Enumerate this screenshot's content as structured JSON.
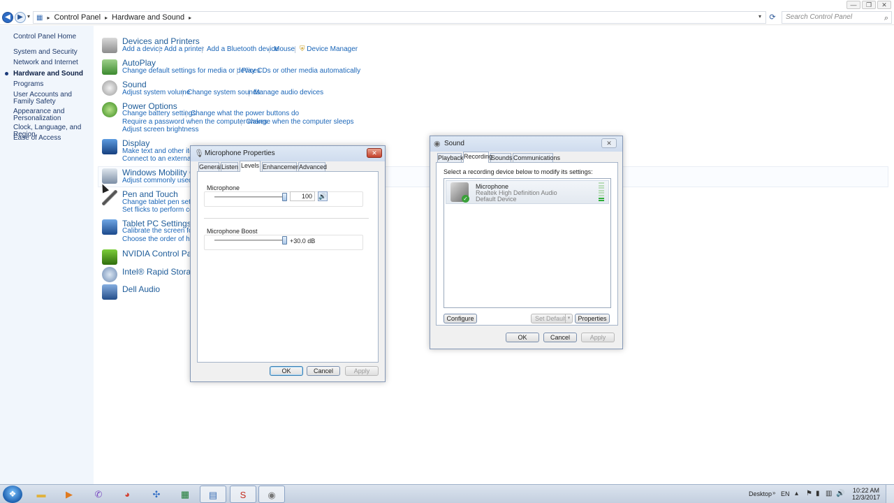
{
  "address": {
    "crumbs": [
      "Control Panel",
      "Hardware and Sound"
    ],
    "search_placeholder": "Search Control Panel"
  },
  "window_controls": {
    "minimize": "—",
    "maximize": "❐",
    "close": "✕"
  },
  "left_pane": {
    "items": [
      "Control Panel Home",
      "System and Security",
      "Network and Internet",
      "Hardware and Sound",
      "Programs",
      "User Accounts and Family Safety",
      "Appearance and Personalization",
      "Clock, Language, and Region",
      "Ease of Access"
    ],
    "active": "Hardware and Sound"
  },
  "categories": [
    {
      "title": "Devices and Printers",
      "links": [
        "Add a device",
        "Add a printer",
        "Add a Bluetooth device",
        "Mouse",
        "Device Manager"
      ]
    },
    {
      "title": "AutoPlay",
      "links": [
        "Change default settings for media or devices",
        "Play CDs or other media automatically"
      ]
    },
    {
      "title": "Sound",
      "links": [
        "Adjust system volume",
        "Change system sounds",
        "Manage audio devices"
      ]
    },
    {
      "title": "Power Options",
      "links": [
        "Change battery settings",
        "Change what the power buttons do",
        "Require a password when the computer wakes",
        "Change when the computer sleeps",
        "Adjust screen brightness"
      ]
    },
    {
      "title": "Display",
      "links": [
        "Make text and other items la",
        "Connect to an external displ"
      ]
    },
    {
      "title": "Windows Mobility Ce",
      "links": [
        "Adjust commonly used mob"
      ]
    },
    {
      "title": "Pen and Touch",
      "links": [
        "Change tablet pen settings",
        "Set flicks to perform certain"
      ]
    },
    {
      "title": "Tablet PC Settings",
      "links": [
        "Calibrate the screen for pen",
        "Choose the order of how yo"
      ]
    },
    {
      "title": "NVIDIA Control Panel",
      "links": []
    },
    {
      "title": "Intel® Rapid Storage",
      "links": []
    },
    {
      "title": "Dell Audio",
      "links": []
    }
  ],
  "mic_dialog": {
    "title": "Microphone Properties",
    "tabs": [
      "General",
      "Listen",
      "Levels",
      "Enhancements",
      "Advanced"
    ],
    "selected_tab": "Levels",
    "microphone": {
      "label": "Microphone",
      "value": "100",
      "level": 1.0
    },
    "boost": {
      "label": "Microphone Boost",
      "value": "+30.0 dB",
      "level": 1.0
    },
    "buttons": {
      "ok": "OK",
      "cancel": "Cancel",
      "apply": "Apply"
    }
  },
  "sound_dialog": {
    "title": "Sound",
    "tabs": [
      "Playback",
      "Recording",
      "Sounds",
      "Communications"
    ],
    "selected_tab": "Recording",
    "instruction": "Select a recording device below to modify its settings:",
    "device": {
      "name": "Microphone",
      "driver": "Realtek High Definition Audio",
      "status": "Default Device"
    },
    "buttons": {
      "configure": "Configure",
      "set_default": "Set Default",
      "properties": "Properties",
      "ok": "OK",
      "cancel": "Cancel",
      "apply": "Apply"
    }
  },
  "taskbar": {
    "desktop_label": "Desktop",
    "language": "EN",
    "time": "10:22 AM",
    "date": "12/3/2017"
  }
}
